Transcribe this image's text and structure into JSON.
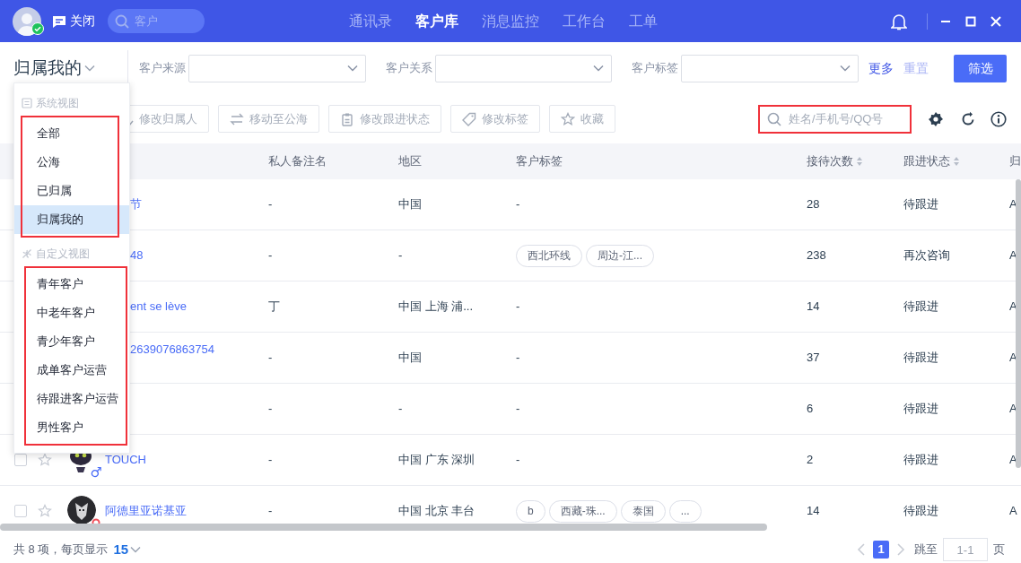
{
  "top_bar": {
    "close_label": "关闭",
    "search_placeholder": "客户",
    "online": true,
    "nav": [
      {
        "label": "通讯录",
        "selected": false
      },
      {
        "label": "客户库",
        "selected": true
      },
      {
        "label": "消息监控",
        "selected": false
      },
      {
        "label": "工作台",
        "selected": false
      },
      {
        "label": "工单",
        "selected": false
      }
    ]
  },
  "view_switcher": {
    "label": "归属我的"
  },
  "filters": [
    {
      "label": "客户来源"
    },
    {
      "label": "客户关系"
    },
    {
      "label": "客户标签"
    }
  ],
  "filter_links": {
    "more": "更多",
    "reset": "重置"
  },
  "filter_button": "筛选",
  "toolbar": {
    "actions": [
      {
        "kind": "owner",
        "label": "修改归属人",
        "disabled": true
      },
      {
        "kind": "move",
        "label": "移动至公海",
        "disabled": true
      },
      {
        "kind": "status",
        "label": "修改跟进状态",
        "disabled": true
      },
      {
        "kind": "tag",
        "label": "修改标签",
        "disabled": true
      },
      {
        "kind": "favorite",
        "label": "收藏",
        "disabled": true
      }
    ],
    "search_placeholder": "姓名/手机号/QQ号",
    "search_highlighted": true
  },
  "table": {
    "columns": [
      {
        "label": "私人备注名",
        "sortable": false
      },
      {
        "label": "地区",
        "sortable": false
      },
      {
        "label": "客户标签",
        "sortable": false
      },
      {
        "label": "接待次数",
        "sortable": true
      },
      {
        "label": "跟进状态",
        "sortable": true
      },
      {
        "label": "归",
        "sortable": false
      }
    ],
    "rows": [
      {
        "covered": true,
        "name": "节",
        "note": "-",
        "region": "中国",
        "tags": [],
        "no_tags": "-",
        "count": "28",
        "status": "待跟进",
        "owner": "A"
      },
      {
        "covered": true,
        "name": "48",
        "note": "-",
        "region": "-",
        "tags": [
          "西北环线",
          "周边-江..."
        ],
        "count": "238",
        "status": "再次咨询",
        "owner": "A"
      },
      {
        "covered": true,
        "name": "ent se lève",
        "note": "丁",
        "region": "中国 上海 浦...",
        "tags": [],
        "no_tags": "-",
        "count": "14",
        "status": "待跟进",
        "owner": "A"
      },
      {
        "covered": true,
        "name": "2639076863754",
        "note": "-",
        "region": "中国",
        "tags": [],
        "no_tags": "-",
        "count": "37",
        "status": "待跟进",
        "owner": "A"
      },
      {
        "note": "-",
        "region": "-",
        "tags": [],
        "no_tags": "-",
        "count": "6",
        "status": "待跟进",
        "owner": "A"
      },
      {
        "covered": false,
        "checked": false,
        "gender_symbol": "♂",
        "name": "TOUCH",
        "note": "-",
        "region": "中国 广东 深圳",
        "tags": [],
        "no_tags": "-",
        "count": "2",
        "status": "待跟进",
        "owner": "A"
      },
      {
        "covered": false,
        "checked": false,
        "red_badge": true,
        "name": "阿德里亚诺基亚",
        "note": "-",
        "region": "中国 北京 丰台",
        "tags": [
          "b",
          "西藏-珠...",
          "泰国",
          "..."
        ],
        "count": "14",
        "status": "待跟进",
        "owner": "A"
      }
    ]
  },
  "view_menu": {
    "sections": [
      {
        "kind": "system",
        "title": "系统视图",
        "highlighted": true,
        "items": [
          {
            "label": "全部",
            "selected": false
          },
          {
            "label": "公海",
            "selected": false
          },
          {
            "label": "已归属",
            "selected": false
          },
          {
            "label": "归属我的",
            "selected": true
          }
        ]
      },
      {
        "kind": "custom",
        "title": "自定义视图",
        "highlighted": true,
        "items": [
          {
            "label": "青年客户",
            "selected": false
          },
          {
            "label": "中老年客户",
            "selected": false
          },
          {
            "label": "青少年客户",
            "selected": false
          },
          {
            "label": "成单客户运营",
            "selected": false
          },
          {
            "label": "待跟进客户运营",
            "selected": false
          },
          {
            "label": "男性客户",
            "selected": false
          }
        ]
      }
    ]
  },
  "pagination": {
    "summary": "共 8 项，每页显示",
    "page_size": "15",
    "pages": [
      {
        "label": "1",
        "selected": true
      }
    ],
    "jump_label": "跳至",
    "jump_placeholder": "1-1",
    "page_suffix": "页"
  }
}
